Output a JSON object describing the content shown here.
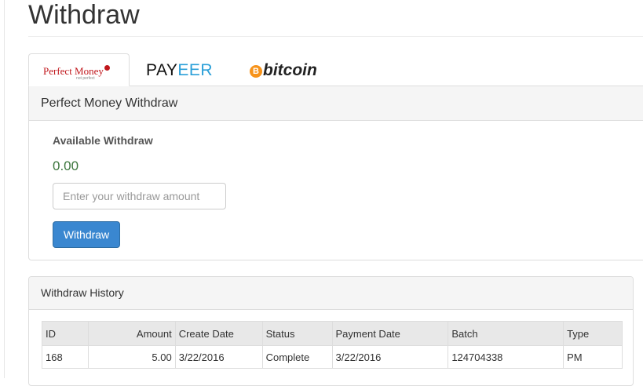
{
  "page": {
    "title": "Withdraw"
  },
  "tabs": [
    {
      "id": "perfect-money",
      "logo_text": "Perfect Money",
      "logo_sub": "not perfect",
      "active": true
    },
    {
      "id": "payeer",
      "logo_text_a": "PAY",
      "logo_text_b": "EER",
      "active": false
    },
    {
      "id": "bitcoin",
      "logo_symbol": "B",
      "logo_text": "bitcoin",
      "active": false
    }
  ],
  "withdraw_panel": {
    "heading": "Perfect Money Withdraw",
    "available_label": "Available Withdraw",
    "balance": "0.00",
    "amount_placeholder": "Enter your withdraw amount",
    "amount_value": "",
    "button_label": "Withdraw"
  },
  "history_panel": {
    "heading": "Withdraw History",
    "columns": [
      "ID",
      "Amount",
      "Create Date",
      "Status",
      "Payment Date",
      "Batch",
      "Type"
    ],
    "rows": [
      [
        "168",
        "5.00",
        "3/22/2016",
        "Complete",
        "3/22/2016",
        "124704338",
        "PM"
      ]
    ]
  },
  "colors": {
    "primary_button": "#3a87d0",
    "balance_text": "#3c763d",
    "perfect_money_red": "#c0161b",
    "payeer_blue": "#2a9fd8",
    "bitcoin_orange": "#f7931a"
  }
}
